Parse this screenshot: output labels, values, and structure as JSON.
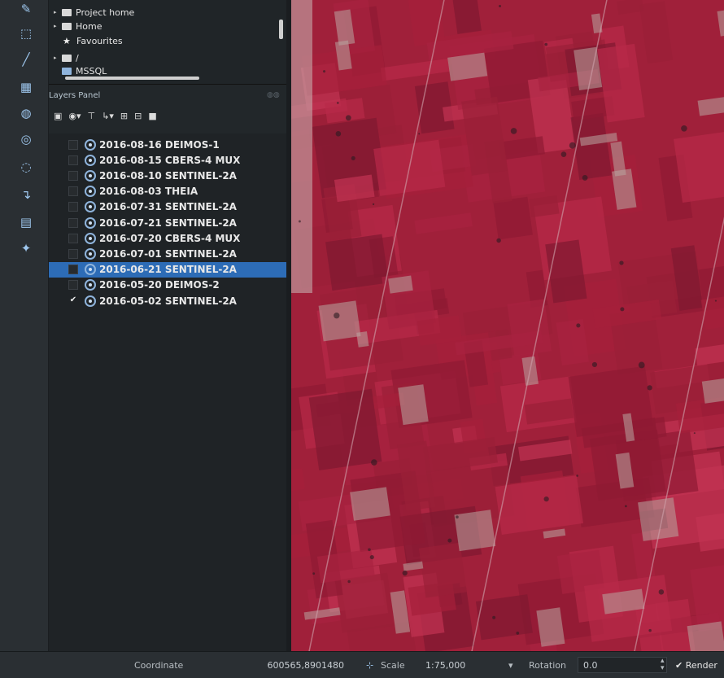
{
  "browser": {
    "items": [
      {
        "label": "Project home",
        "icon": "folder-icon"
      },
      {
        "label": "Home",
        "icon": "folder-icon"
      },
      {
        "label": "Favourites",
        "icon": "star-icon"
      },
      {
        "label": "/",
        "icon": "folder-icon"
      },
      {
        "label": "MSSQL",
        "icon": "database-icon"
      }
    ]
  },
  "layers_panel": {
    "title": "Layers Panel",
    "layers": [
      {
        "label": "2016-08-16 DEIMOS-1",
        "checked": false,
        "selected": false
      },
      {
        "label": "2016-08-15 CBERS-4 MUX",
        "checked": false,
        "selected": false
      },
      {
        "label": "2016-08-10 SENTINEL-2A",
        "checked": false,
        "selected": false
      },
      {
        "label": "2016-08-03 THEIA",
        "checked": false,
        "selected": false
      },
      {
        "label": "2016-07-31 SENTINEL-2A",
        "checked": false,
        "selected": false
      },
      {
        "label": "2016-07-21 SENTINEL-2A",
        "checked": false,
        "selected": false
      },
      {
        "label": "2016-07-20 CBERS-4 MUX",
        "checked": false,
        "selected": false
      },
      {
        "label": "2016-07-01 SENTINEL-2A",
        "checked": false,
        "selected": false
      },
      {
        "label": "2016-06-21 SENTINEL-2A",
        "checked": false,
        "selected": true
      },
      {
        "label": "2016-05-20 DEIMOS-2",
        "checked": false,
        "selected": false
      },
      {
        "label": "2016-05-02 SENTINEL-2A",
        "checked": true,
        "selected": false
      }
    ]
  },
  "status": {
    "coordinate_label": "Coordinate",
    "coordinate_value": "600565,8901480",
    "scale_label": "Scale",
    "scale_value": "1:75,000",
    "rotation_label": "Rotation",
    "rotation_value": "0.0",
    "render_label": "Render"
  },
  "colors": {
    "selection": "#2d6cb6",
    "map_base": "#a0203a",
    "panel_bg": "#1f2326"
  }
}
